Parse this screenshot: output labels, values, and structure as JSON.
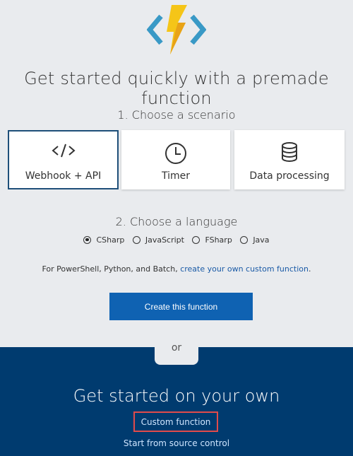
{
  "headline": "Get started quickly with a premade function",
  "step1": {
    "label": "1. Choose a scenario",
    "cards": [
      {
        "label": "Webhook + API",
        "icon": "code-icon",
        "selected": true
      },
      {
        "label": "Timer",
        "icon": "clock-icon",
        "selected": false
      },
      {
        "label": "Data processing",
        "icon": "database-icon",
        "selected": false
      }
    ]
  },
  "step2": {
    "label": "2. Choose a language",
    "languages": [
      {
        "label": "CSharp",
        "selected": true
      },
      {
        "label": "JavaScript",
        "selected": false
      },
      {
        "label": "FSharp",
        "selected": false
      },
      {
        "label": "Java",
        "selected": false
      }
    ]
  },
  "note": {
    "text": "For PowerShell, Python, and Batch, ",
    "link": "create your own custom function",
    "suffix": "."
  },
  "create_button": "Create this function",
  "or_label": "or",
  "own": {
    "title": "Get started on your own",
    "custom_link": "Custom function",
    "source_link": "Start from source control"
  },
  "colors": {
    "background": "#e9ebee",
    "dark_panel": "#003b6f",
    "primary_button": "#0f62b2",
    "selected_border": "#1e4f79",
    "highlight_box": "#e24b4b",
    "logo_bolt": "#f5c518",
    "logo_brackets": "#3999c6"
  }
}
